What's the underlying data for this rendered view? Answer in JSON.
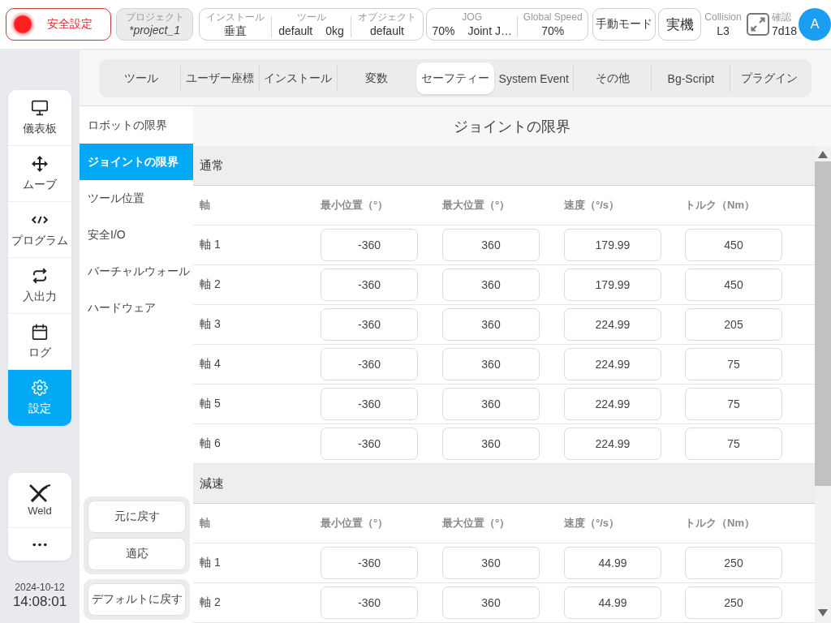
{
  "top_bar": {
    "safety_button": {
      "label": "安全設定"
    },
    "project": {
      "label": "プロジェクト",
      "value": "*project_1"
    },
    "installation": [
      {
        "label": "インストール",
        "values": [
          "垂直"
        ]
      },
      {
        "label": "ツール",
        "values": [
          "default",
          "0kg"
        ]
      },
      {
        "label": "オブジェクト",
        "values": [
          "default"
        ]
      }
    ],
    "motion": [
      {
        "label": "JOG",
        "values": [
          "70%",
          "Joint J…"
        ]
      },
      {
        "label": "Global Speed",
        "values": [
          "70%"
        ]
      }
    ],
    "mode_buttons": [
      "手動モード",
      "実機"
    ],
    "collision": {
      "label": "Collision",
      "value": "L3"
    },
    "confirm": {
      "label": "確認",
      "value": "7d18"
    },
    "avatar": {
      "initial": "A"
    }
  },
  "nav": {
    "items": [
      {
        "label": "儀表板",
        "selected": false
      },
      {
        "label": "ムーブ",
        "selected": false
      },
      {
        "label": "プログラム",
        "selected": false
      },
      {
        "label": "入出力",
        "selected": false
      },
      {
        "label": "ログ",
        "selected": false
      },
      {
        "label": "設定",
        "selected": true
      }
    ],
    "extra_items": [
      {
        "label": "Weld"
      }
    ]
  },
  "clock": {
    "date": "2024-10-12",
    "time": "14:08:01"
  },
  "tabs": [
    {
      "label": "ツール",
      "selected": false
    },
    {
      "label": "ユーザー座標",
      "selected": false
    },
    {
      "label": "インストール",
      "selected": false
    },
    {
      "label": "変数",
      "selected": false
    },
    {
      "label": "セーフティー",
      "selected": true
    },
    {
      "label": "System Event",
      "selected": false
    },
    {
      "label": "その他",
      "selected": false
    },
    {
      "label": "Bg-Script",
      "selected": false
    },
    {
      "label": "プラグイン",
      "selected": false
    }
  ],
  "submenu": {
    "items": [
      {
        "label": "ロボットの限界",
        "selected": false
      },
      {
        "label": "ジョイントの限界",
        "selected": true
      },
      {
        "label": "ツール位置",
        "selected": false
      },
      {
        "label": "安全I/O",
        "selected": false
      },
      {
        "label": "バーチャルウォール",
        "selected": false
      },
      {
        "label": "ハードウェア",
        "selected": false
      }
    ],
    "actions": [
      "元に戻す",
      "適応"
    ],
    "reset": "デフォルトに戻す"
  },
  "content": {
    "title": "ジョイントの限界",
    "sections": [
      {
        "title": "通常",
        "columns": [
          "軸",
          "最小位置（°）",
          "最大位置（°）",
          "速度（°/s）",
          "トルク（Nm）"
        ],
        "rows": [
          {
            "axis": "軸 1",
            "values": [
              "-360",
              "360",
              "179.99",
              "450"
            ]
          },
          {
            "axis": "軸 2",
            "values": [
              "-360",
              "360",
              "179.99",
              "450"
            ]
          },
          {
            "axis": "軸 3",
            "values": [
              "-360",
              "360",
              "224.99",
              "205"
            ]
          },
          {
            "axis": "軸 4",
            "values": [
              "-360",
              "360",
              "224.99",
              "75"
            ]
          },
          {
            "axis": "軸 5",
            "values": [
              "-360",
              "360",
              "224.99",
              "75"
            ]
          },
          {
            "axis": "軸 6",
            "values": [
              "-360",
              "360",
              "224.99",
              "75"
            ]
          }
        ]
      },
      {
        "title": "減速",
        "columns": [
          "軸",
          "最小位置（°）",
          "最大位置（°）",
          "速度（°/s）",
          "トルク（Nm）"
        ],
        "rows": [
          {
            "axis": "軸 1",
            "values": [
              "-360",
              "360",
              "44.99",
              "250"
            ]
          },
          {
            "axis": "軸 2",
            "values": [
              "-360",
              "360",
              "44.99",
              "250"
            ]
          }
        ]
      }
    ]
  }
}
